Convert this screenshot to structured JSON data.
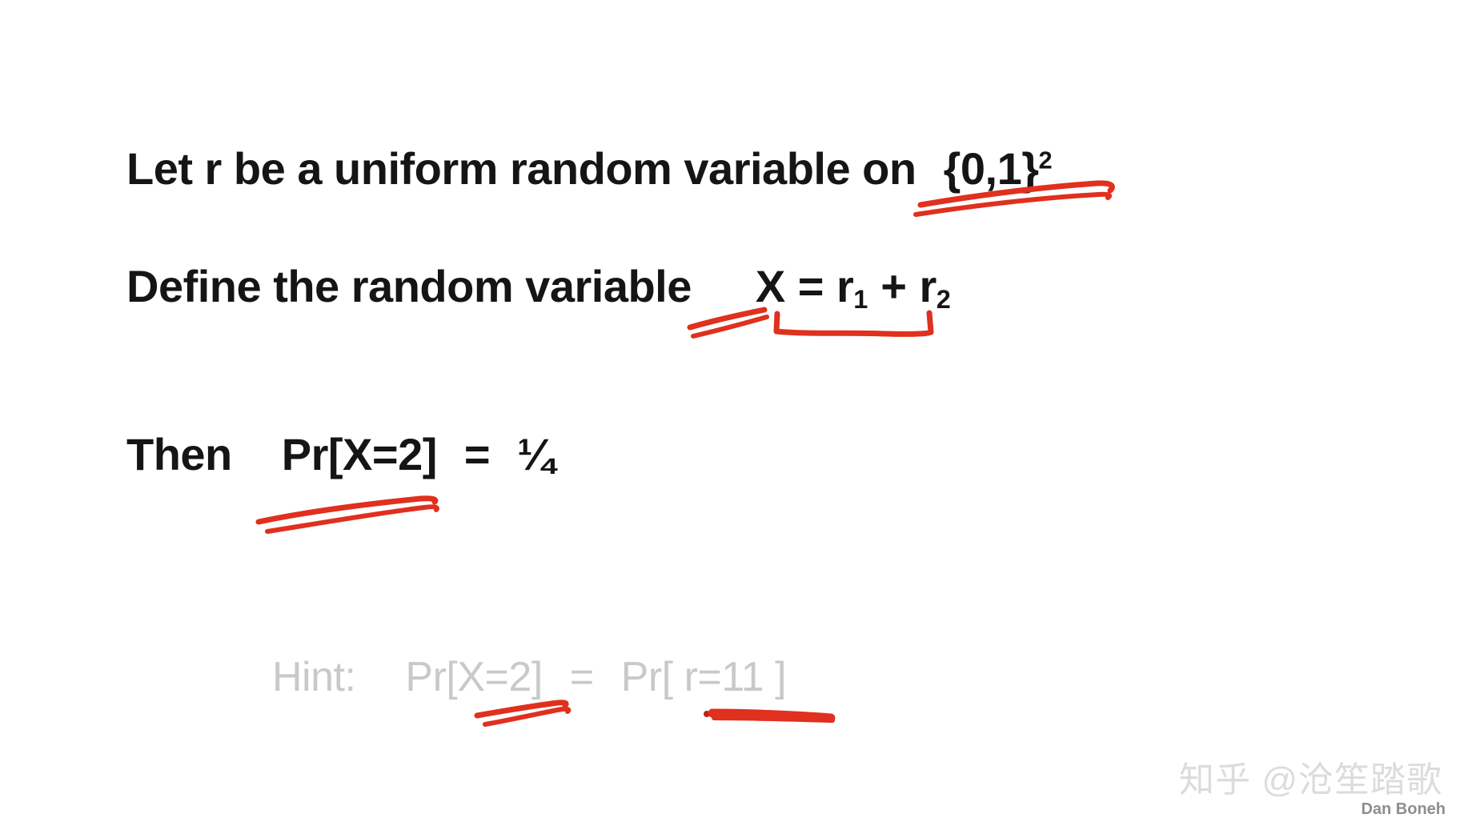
{
  "slide": {
    "background_color": "#ffffff",
    "text_color": "#151515",
    "hint_color": "#c9c9c9",
    "ink_color": "#e0301e",
    "watermark_color": "#dcdcdc"
  },
  "lines": {
    "line1": {
      "prefix": "Let  r  be a uniform random variable on",
      "set": "{0,1}",
      "exponent": "2"
    },
    "line2": {
      "prefix": "Define the random variable",
      "var": "X",
      "equals": "=",
      "term1_base": "r",
      "term1_sub": "1",
      "plus": "+",
      "term2_base": "r",
      "term2_sub": "2"
    },
    "line3": {
      "then": "Then",
      "probability": "Pr[X=2]",
      "equals": "=",
      "value": "¼"
    },
    "line4": {
      "label": "Hint:",
      "left_probability": "Pr[X=2]",
      "equals": "=",
      "right_probability": "Pr[ r=11 ]"
    }
  },
  "annotations": {
    "underline_set": "double red underline beneath {0,1}^2",
    "underline_x": "double slanted red underline beneath X",
    "underbrace_r1r2": "red underbrace beneath r1 + r2",
    "underline_pr_x2": "double slanted red underline beneath Pr[X=2]",
    "underline_hint_pr_x2": "double slanted red underline beneath hint Pr[X=2]",
    "underline_hint_r11": "thick red underline beneath Pr[ r=11 ]",
    "dot_hint": "small red dot before Pr[ r=11 ] underline"
  },
  "watermark": {
    "text": "知乎 @沧笙踏歌"
  },
  "credit": {
    "author": "Dan Boneh"
  }
}
